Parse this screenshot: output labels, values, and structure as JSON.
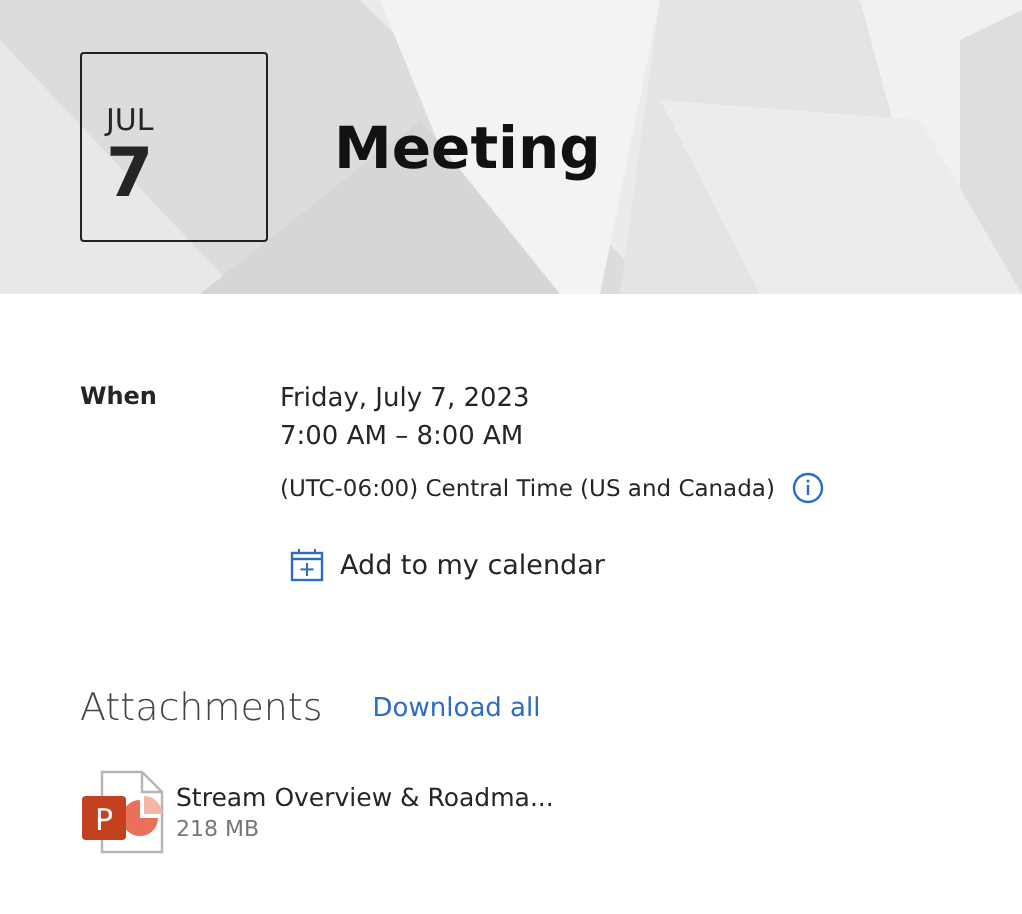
{
  "header": {
    "kind": "picture",
    "month": "JUL",
    "day": "7",
    "title": "Meeting"
  },
  "details": {
    "label": "When",
    "date": "Friday, July 7, 2023",
    "time": "7:00 AM – 8:00 AM",
    "timezone": "(UTC-06:00) Central Time (US and Canada)",
    "add_calendar": "Add to my calendar"
  },
  "attachments": {
    "heading": "Attachments",
    "download_all": "Download all",
    "files": [
      {
        "name": "Stream Overview & Roadma...",
        "size": "218 MB",
        "icon_letter": "P"
      }
    ]
  }
}
